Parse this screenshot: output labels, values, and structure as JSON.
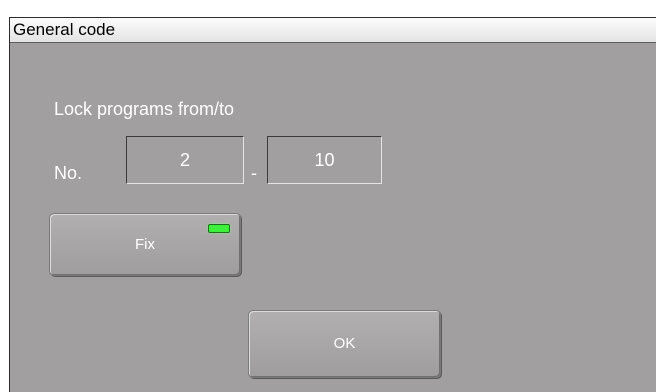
{
  "window": {
    "title": "General code"
  },
  "lock": {
    "heading": "Lock programs from/to",
    "no_label": "No.",
    "from_value": "2",
    "separator": "-",
    "to_value": "10"
  },
  "buttons": {
    "fix_label": "Fix",
    "fix_indicator": {
      "state": "on",
      "color": "#3cf03c"
    },
    "ok_label": "OK"
  }
}
